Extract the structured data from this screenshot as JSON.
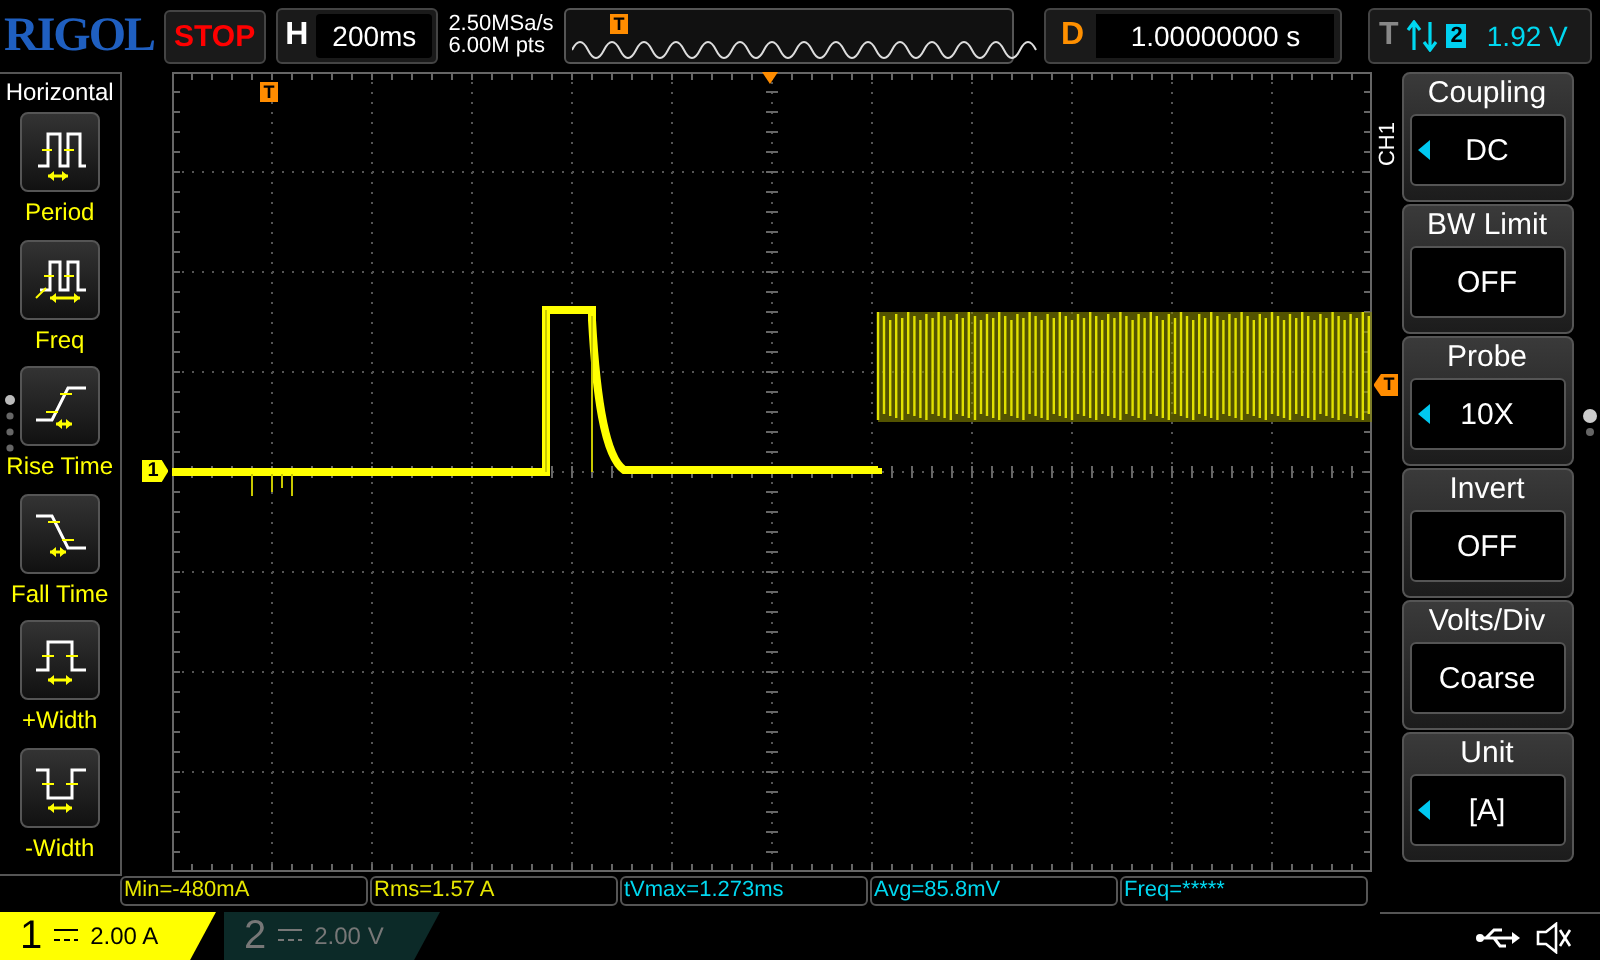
{
  "header": {
    "logo": "RIGOL",
    "run_state": "STOP",
    "timebase": {
      "label": "H",
      "value": "200ms"
    },
    "sample_rate": "2.50MSa/s",
    "memory_depth": "6.00M pts",
    "overview_marker": "T",
    "delay": {
      "label": "D",
      "value": "1.00000000 s"
    },
    "trigger": {
      "label": "T",
      "source": "2",
      "level": "1.92 V"
    }
  },
  "left_menu": {
    "title": "Horizontal",
    "items": [
      {
        "label": "Period",
        "kind": "period"
      },
      {
        "label": "Freq",
        "kind": "freq"
      },
      {
        "label": "Rise Time",
        "kind": "rise"
      },
      {
        "label": "Fall Time",
        "kind": "fall"
      },
      {
        "label": "+Width",
        "kind": "pwidth"
      },
      {
        "label": "-Width",
        "kind": "nwidth"
      }
    ]
  },
  "screen": {
    "trigger_position_marker": "T",
    "trigger_level_marker": "T",
    "channel_marker": "1",
    "menu_channel": "CH1"
  },
  "right_menu": {
    "items": [
      {
        "title": "Coupling",
        "value": "DC",
        "adjustable": true
      },
      {
        "title": "BW Limit",
        "value": "OFF",
        "adjustable": false
      },
      {
        "title": "Probe",
        "value": "10X",
        "adjustable": true
      },
      {
        "title": "Invert",
        "value": "OFF",
        "adjustable": false
      },
      {
        "title": "Volts/Div",
        "value": "Coarse",
        "adjustable": false
      },
      {
        "title": "Unit",
        "value": "[A]",
        "adjustable": true
      }
    ]
  },
  "measurements": [
    {
      "text": "Min=-480mA",
      "color": "#e6e600"
    },
    {
      "text": "Rms=1.57 A",
      "color": "#e6e600"
    },
    {
      "text": "tVmax=1.273ms",
      "color": "#00d8f0"
    },
    {
      "text": "Avg=85.8mV",
      "color": "#00d8f0"
    },
    {
      "text": "Freq=*****",
      "color": "#00d8f0"
    }
  ],
  "channels": [
    {
      "number": "1",
      "scale": "2.00 A",
      "active": true
    },
    {
      "number": "2",
      "scale": "2.00 V",
      "active": false
    }
  ]
}
